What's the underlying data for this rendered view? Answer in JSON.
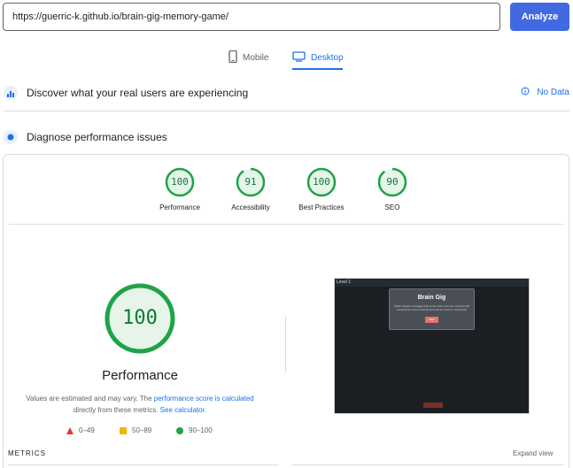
{
  "search": {
    "url": "https://guerric-k.github.io/brain-gig-memory-game/",
    "analyze_label": "Analyze"
  },
  "tabs": [
    {
      "label": "Mobile",
      "icon": "phone-icon",
      "active": false
    },
    {
      "label": "Desktop",
      "icon": "monitor-icon",
      "active": true
    }
  ],
  "sections": {
    "real_users": "Discover what your real users are experiencing",
    "no_data": "No Data",
    "diagnose": "Diagnose performance issues"
  },
  "scores": [
    {
      "label": "Performance",
      "value": "100",
      "fraction": 1.0
    },
    {
      "label": "Accessibility",
      "value": "91",
      "fraction": 0.91
    },
    {
      "label": "Best Practices",
      "value": "100",
      "fraction": 1.0
    },
    {
      "label": "SEO",
      "value": "90",
      "fraction": 0.9
    }
  ],
  "main_score": {
    "value": "100",
    "title": "Performance",
    "note_prefix": "Values are estimated and may vary. The ",
    "note_link1": "performance score is calculated",
    "note_mid": "directly from these metrics. ",
    "note_link2": "See calculator."
  },
  "legend": [
    {
      "label": "0–49",
      "color": "#e53935"
    },
    {
      "label": "50–89",
      "color": "#f4b400"
    },
    {
      "label": "90–100",
      "color": "#1ea446"
    }
  ],
  "screenshot": {
    "level": "Level 1",
    "title": "Brain Gig",
    "text": "Match all pairs of images before the timer runs out. You have 60 seconds for Level 1 and 45 seconds for Level 2. Good luck!",
    "button": "Start"
  },
  "footer": {
    "metrics_label": "METRICS",
    "expand_label": "Expand view"
  },
  "colors": {
    "accent": "#1a73e8",
    "analyze_button": "#4169e1",
    "pass_green": "#1ea446",
    "pass_text": "#0a7a35"
  }
}
